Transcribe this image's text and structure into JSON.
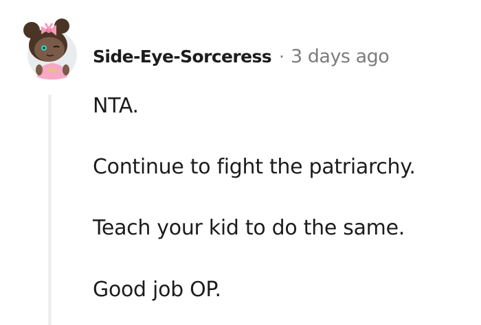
{
  "comment": {
    "author": "Side-Eye-Sorceress",
    "separator": "·",
    "timestamp": "3 days ago",
    "avatar_icon": "snoo-avatar-icon",
    "paragraphs": [
      "NTA.",
      "Continue to fight the patriarchy.",
      "Teach your kid to do the same.",
      "Good job OP."
    ]
  },
  "colors": {
    "text": "#1c1c1c",
    "meta": "#7c7c7c",
    "thread_line": "#edeff1",
    "avatar_bg": "#e9ecee",
    "hair": "#4a3426",
    "skin": "#7a5a48",
    "bow": "#f79ab8",
    "shirt": "#f6a9c4"
  }
}
